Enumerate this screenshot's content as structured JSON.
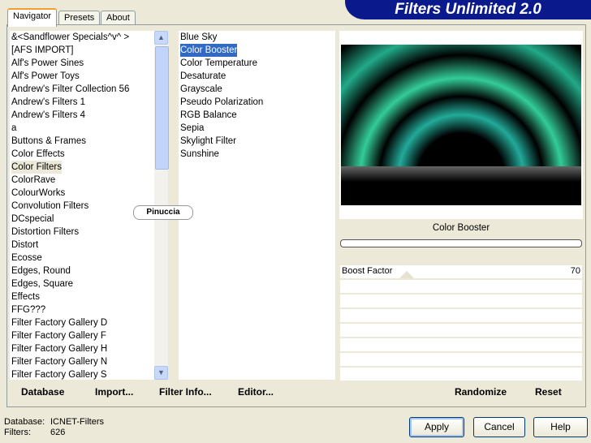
{
  "title": "Filters Unlimited 2.0",
  "tabs": [
    {
      "label": "Navigator",
      "active": true
    },
    {
      "label": "Presets"
    },
    {
      "label": "About"
    }
  ],
  "categories": [
    "&<Sandflower Specials^v^ >",
    "[AFS IMPORT]",
    "Alf's Power Sines",
    "Alf's Power Toys",
    "Andrew's Filter Collection 56",
    "Andrew's Filters 1",
    "Andrew's Filters 4",
    "a",
    "Buttons & Frames",
    "Color Effects",
    "Color Filters",
    "ColorRave",
    "ColourWorks",
    "Convolution Filters",
    "DCspecial",
    "Distortion Filters",
    "Distort",
    "Ecosse",
    "Edges, Round",
    "Edges, Square",
    "Effects",
    "FFG???",
    "Filter Factory Gallery D",
    "Filter Factory Gallery F",
    "Filter Factory Gallery H",
    "Filter Factory Gallery N",
    "Filter Factory Gallery S"
  ],
  "selected_category": "Color Filters",
  "filters": [
    "Blue Sky",
    "Color Booster",
    "Color Temperature",
    "Desaturate",
    "Grayscale",
    "Pseudo Polarization",
    "RGB Balance",
    "Sepia",
    "Skylight Filter",
    "Sunshine"
  ],
  "selected_filter": "Color Booster",
  "watermark": "Pinuccia",
  "preview": {
    "filter_name": "Color Booster",
    "accent": "#40e0a0"
  },
  "params": [
    {
      "label": "Boost Factor",
      "value": 70,
      "max": 255
    }
  ],
  "toolbar": {
    "database": "Database",
    "import": "Import...",
    "filter_info": "Filter Info...",
    "editor": "Editor...",
    "randomize": "Randomize",
    "reset": "Reset"
  },
  "status": {
    "database_label": "Database:",
    "database_value": "ICNET-Filters",
    "filters_label": "Filters:",
    "filters_value": "626"
  },
  "buttons": {
    "apply": "Apply",
    "cancel": "Cancel",
    "help": "Help"
  }
}
